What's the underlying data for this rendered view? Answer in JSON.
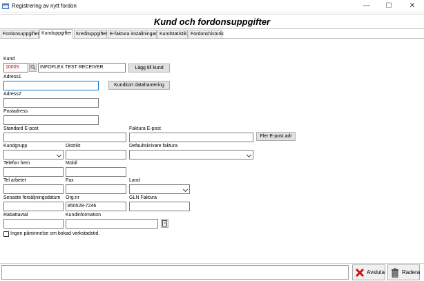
{
  "window": {
    "title": "Registrering av nytt fordon",
    "minimize_glyph": "—",
    "maximize_glyph": "☐",
    "close_glyph": "✕"
  },
  "header": {
    "title": "Kund och fordonsuppgifter"
  },
  "tabs": [
    {
      "label": "Fordonsuppgifter",
      "active": false
    },
    {
      "label": "Kunduppgifter",
      "active": true
    },
    {
      "label": "Kredituppgifter",
      "active": false
    },
    {
      "label": "E-faktura inställningar",
      "active": false
    },
    {
      "label": "Kundstatistik",
      "active": false
    },
    {
      "label": "Fordonshistorik",
      "active": false
    }
  ],
  "form": {
    "kund": {
      "label": "Kund",
      "number": "10005",
      "name": "INFOFLEX TEST RECEIVER"
    },
    "buttons": {
      "add_customer": "Lägg till kund",
      "customer_card": "Kundkort datahantering",
      "more_email": "Fler E-post adr"
    },
    "adress1": {
      "label": "Adress1",
      "value": ""
    },
    "adress2": {
      "label": "Adress2",
      "value": ""
    },
    "postadress": {
      "label": "Postadress",
      "value": ""
    },
    "standard_email": {
      "label": "Standard E-post",
      "value": ""
    },
    "invoice_email": {
      "label": "Faktura E-post",
      "value": ""
    },
    "kundgrupp": {
      "label": "Kundgrupp",
      "value": ""
    },
    "distrikt": {
      "label": "Distrikt",
      "value": ""
    },
    "default_printer": {
      "label": "Defaultskrivare faktura",
      "value": ""
    },
    "telefon_hem": {
      "label": "Telefon hem",
      "value": ""
    },
    "mobil": {
      "label": "Mobil",
      "value": ""
    },
    "tel_arbetet": {
      "label": "Tel arbetet",
      "value": ""
    },
    "fax": {
      "label": "Fax",
      "value": ""
    },
    "land": {
      "label": "Land",
      "value": ""
    },
    "senaste_forsaljning": {
      "label": "Senaste försäljningsdatum",
      "value": ""
    },
    "orgnr": {
      "label": "Org.nr",
      "value": "850528-7246"
    },
    "gln": {
      "label": "GLN Faktura",
      "value": ""
    },
    "rabattavtal": {
      "label": "Rabattavtal",
      "value": ""
    },
    "kundinformation": {
      "label": "Kundinformation",
      "value": ""
    },
    "reminder": {
      "label": "Ingen påminnelse om bokad verkstadstid.",
      "checked": false
    }
  },
  "footer": {
    "status_text": "",
    "close_label": "Avsluta",
    "delete_label": "Radera"
  },
  "colors": {
    "accent_focus": "#0078d7",
    "customer_number": "#c00000",
    "close_icon": "#cc1111"
  }
}
